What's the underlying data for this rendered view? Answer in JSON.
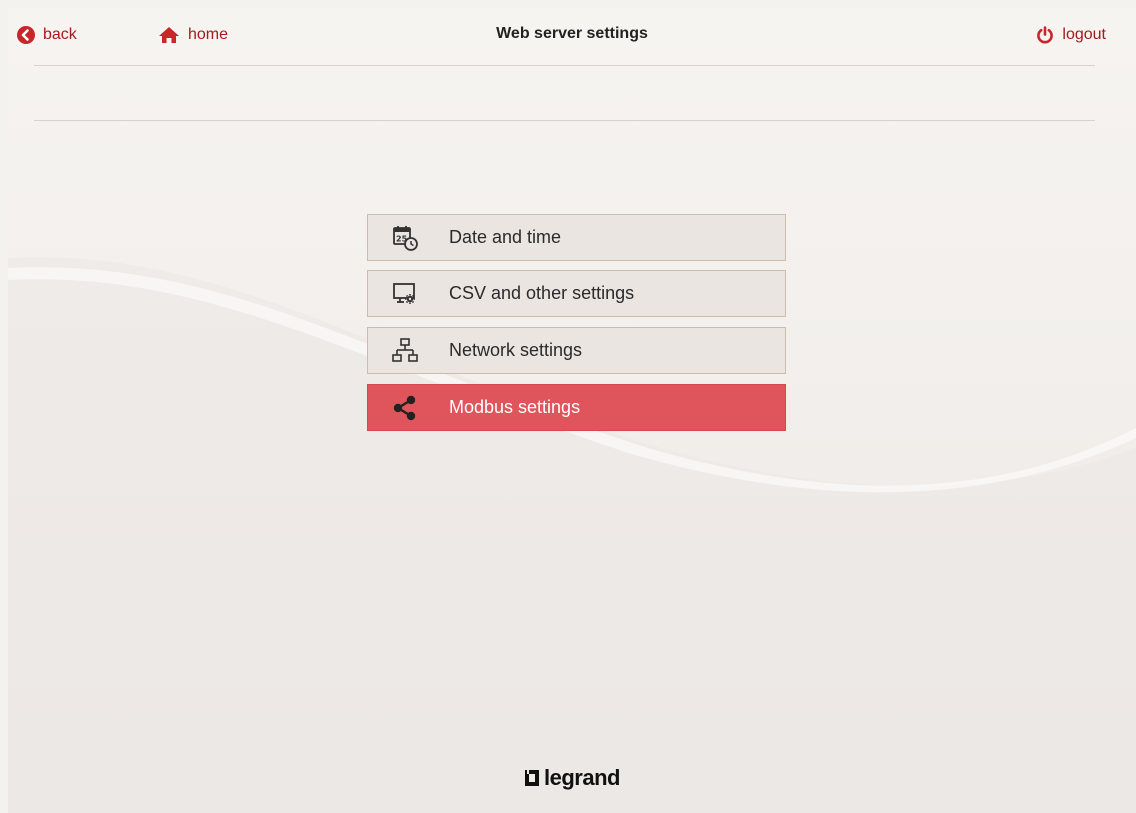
{
  "header": {
    "back_label": "back",
    "home_label": "home",
    "title": "Web server settings",
    "logout_label": "logout"
  },
  "menu": {
    "items": [
      {
        "label": "Date and time",
        "icon": "calendar-clock-icon",
        "active": false
      },
      {
        "label": "CSV and other settings",
        "icon": "monitor-gear-icon",
        "active": false
      },
      {
        "label": "Network settings",
        "icon": "network-icon",
        "active": false
      },
      {
        "label": "Modbus settings",
        "icon": "share-icon",
        "active": true
      }
    ]
  },
  "footer": {
    "brand": "legrand"
  },
  "colors": {
    "accent": "#a6191c",
    "active_item": "#e0555b",
    "item_bg": "#ebe5e1",
    "item_border": "#cbbdaa"
  }
}
